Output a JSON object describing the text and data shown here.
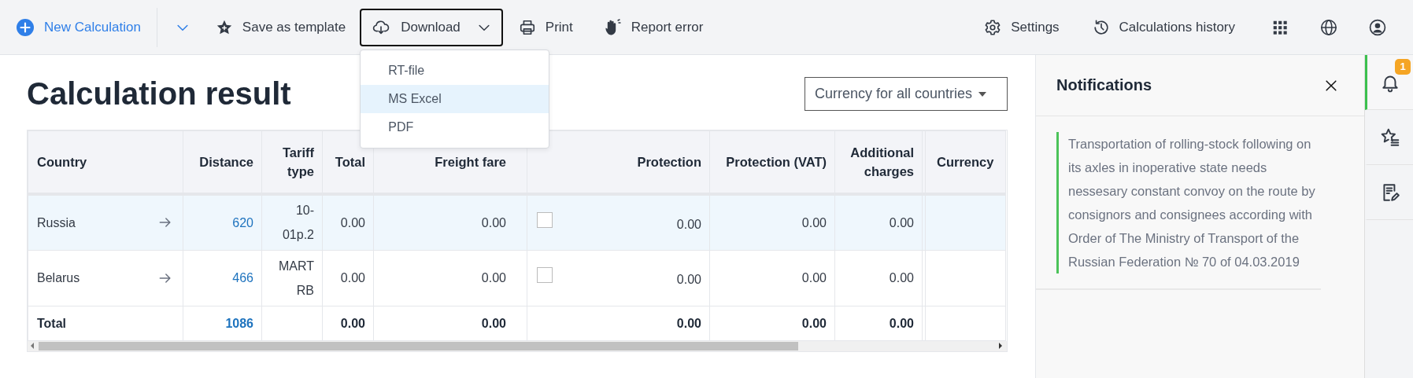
{
  "toolbar": {
    "new_calculation": "New Calculation",
    "save_as_template": "Save as template",
    "download": {
      "label": "Download",
      "expanded": true
    },
    "print": "Print",
    "report_error": "Report error",
    "settings": "Settings",
    "calculations_history": "Calculations history"
  },
  "download_menu": [
    {
      "label": "RT-file",
      "selected": false
    },
    {
      "label": "MS Excel",
      "selected": true
    },
    {
      "label": "PDF",
      "selected": false
    }
  ],
  "page_title": "Calculation result",
  "currency_select": {
    "label": "Currency for all countries"
  },
  "table": {
    "columns": [
      "Country",
      "Distance",
      "Tariff type",
      "Total",
      "Freight fare",
      "Protection",
      "Protection (VAT)",
      "Additional charges",
      "Currency"
    ],
    "rows": [
      {
        "country": "Russia",
        "distance": "620",
        "tariff_type": "10-01p.2",
        "total": "0.00",
        "freight_fare": "0.00",
        "protection_checked": false,
        "protection": "0.00",
        "protection_vat": "0.00",
        "additional_charges": "0.00",
        "selected": true
      },
      {
        "country": "Belarus",
        "distance": "466",
        "tariff_type": "MART RB",
        "total": "0.00",
        "freight_fare": "0.00",
        "protection_checked": false,
        "protection": "0.00",
        "protection_vat": "0.00",
        "additional_charges": "0.00",
        "selected": false
      }
    ],
    "total_row": {
      "label": "Total",
      "distance": "1086",
      "total": "0.00",
      "freight_fare": "0.00",
      "protection": "0.00",
      "protection_vat": "0.00",
      "additional_charges": "0.00"
    }
  },
  "notifications": {
    "title": "Notifications",
    "messages": [
      "Transportation of rolling-stock following on its axles in inoperative state needs nessesary constant convoy on the route by consignors and consignees according with Order of The Ministry of Transport of the Russian Federation № 70 of 04.03.2019"
    ]
  },
  "side_rail": [
    {
      "kind": "notifications",
      "selected": true,
      "badge": "1"
    },
    {
      "kind": "favorites",
      "selected": false
    },
    {
      "kind": "notes",
      "selected": false
    }
  ]
}
